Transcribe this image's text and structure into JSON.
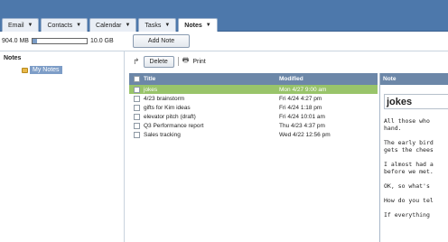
{
  "tabs": [
    {
      "label": "Email",
      "active": false
    },
    {
      "label": "Contacts",
      "active": false
    },
    {
      "label": "Calendar",
      "active": false
    },
    {
      "label": "Tasks",
      "active": false
    },
    {
      "label": "Notes",
      "active": true
    }
  ],
  "quota": {
    "used": "904.0 MB",
    "total": "10.0 GB",
    "fraction": 0.088
  },
  "add_note_label": "Add Note",
  "sidebar": {
    "title": "Notes",
    "folder_label": "My Notes"
  },
  "toolbar": {
    "delete_label": "Delete",
    "print_label": "Print"
  },
  "list": {
    "headers": {
      "title": "Title",
      "modified": "Modified"
    },
    "rows": [
      {
        "title": "jokes",
        "modified": "Mon 4/27 9:00 am",
        "selected": true
      },
      {
        "title": "4/23 brainstorm",
        "modified": "Fri 4/24 4:27 pm",
        "selected": false
      },
      {
        "title": "gifts for Kim ideas",
        "modified": "Fri 4/24 1:18 pm",
        "selected": false
      },
      {
        "title": "elevator pitch (draft)",
        "modified": "Fri 4/24 10:01 am",
        "selected": false
      },
      {
        "title": "Q3 Performance report",
        "modified": "Thu 4/23 4:37 pm",
        "selected": false
      },
      {
        "title": "Sales tracking",
        "modified": "Wed 4/22 12:56 pm",
        "selected": false
      }
    ]
  },
  "note": {
    "header": "Note",
    "title": "jokes",
    "lines": [
      "All those who",
      "hand.",
      "The early bird",
      "gets the chees",
      "I almost had a",
      "before we met.",
      "OK, so what's",
      "How do you tel",
      "If everything"
    ]
  },
  "colors": {
    "accent": "#4d78ab",
    "selected_row": "#99c46a",
    "header": "#6c87a8"
  }
}
